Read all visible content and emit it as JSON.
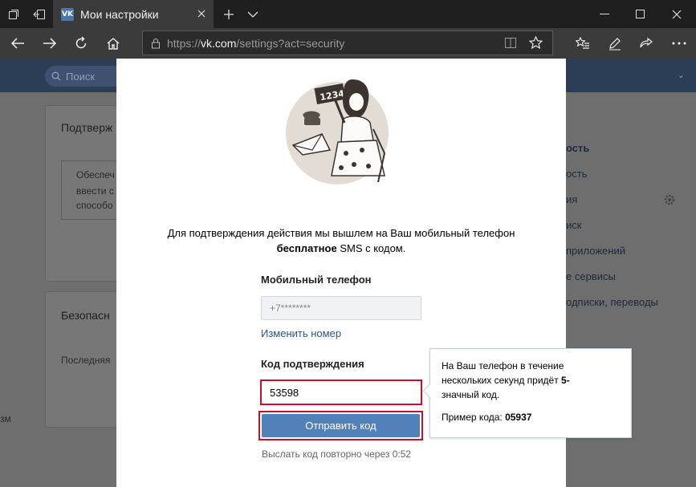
{
  "browser": {
    "tab_title": "Мои настройки",
    "tab_favicon": "VK",
    "url_prefix": "https://",
    "url_host": "vk.com",
    "url_path": "/settings?act=security"
  },
  "background": {
    "search_placeholder": "Поиск",
    "card1_title": "Подтверж",
    "card1_lines": [
      "Обеспеч",
      "ввести с",
      "способо"
    ],
    "card2_title": "Безопасн",
    "card2_text": "Последняя",
    "left_edge_text": "зм",
    "menu_items": [
      "ость",
      "ость",
      "ия",
      "иск",
      "приложений",
      "е сервисы",
      "одписки, переводы"
    ]
  },
  "modal": {
    "message_line1": "Для подтверждения действия мы вышлем на Ваш мобильный телефон",
    "message_bold": "бесплатное",
    "message_rest": " SMS с кодом.",
    "illustration_sign": "1234",
    "phone_label": "Мобильный телефон",
    "phone_value": "+7********",
    "change_link": "Изменить номер",
    "code_label": "Код подтверждения",
    "code_value": "53598",
    "send_button": "Отправить код",
    "resend_text": "Выслать код повторно через 0:52"
  },
  "tooltip": {
    "line1": "На Ваш телефон в течение",
    "line2_prefix": "нескольких секунд придёт ",
    "line2_bold": "5-",
    "line3": "значный код.",
    "example_prefix": "Пример кода: ",
    "example_code": "05937"
  },
  "colors": {
    "accent": "#5181b8",
    "link": "#2a5885",
    "highlight": "#c8102e"
  }
}
